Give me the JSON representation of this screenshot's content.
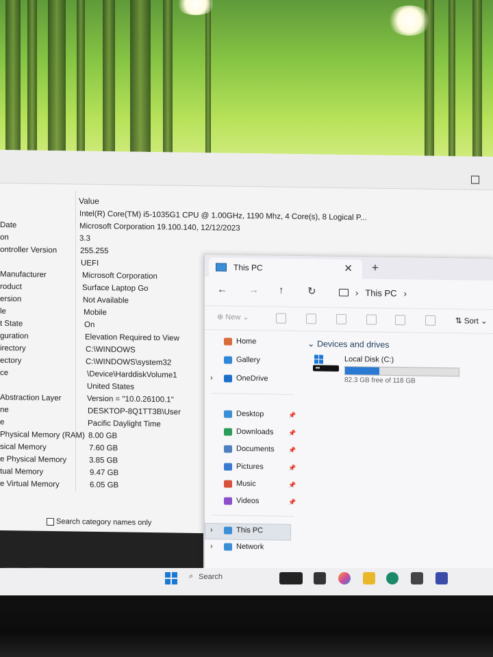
{
  "sysinfo": {
    "column_header": "Value",
    "rows": [
      {
        "item": "",
        "value": "Intel(R) Core(TM) i5-1035G1 CPU @ 1.00GHz, 1190 Mhz, 4 Core(s), 8 Logical P..."
      },
      {
        "item": "Date",
        "value": "Microsoft Corporation 19.100.140, 12/12/2023"
      },
      {
        "item": "on",
        "value": "3.3"
      },
      {
        "item": "ontroller Version",
        "value": "255.255"
      },
      {
        "item": "",
        "value": "UEFI"
      },
      {
        "item": "Manufacturer",
        "value": "Microsoft Corporation"
      },
      {
        "item": "roduct",
        "value": "Surface Laptop Go"
      },
      {
        "item": "ersion",
        "value": "Not Available"
      },
      {
        "item": "le",
        "value": "Mobile"
      },
      {
        "item": "t State",
        "value": "On"
      },
      {
        "item": "guration",
        "value": "Elevation Required to View"
      },
      {
        "item": "irectory",
        "value": "C:\\WINDOWS"
      },
      {
        "item": "ectory",
        "value": "C:\\WINDOWS\\system32"
      },
      {
        "item": "ce",
        "value": "\\Device\\HarddiskVolume1"
      },
      {
        "item": "",
        "value": "United States"
      },
      {
        "item": "Abstraction Layer",
        "value": "Version = \"10.0.26100.1\""
      },
      {
        "item": "ne",
        "value": "DESKTOP-8Q1TT3B\\User"
      },
      {
        "item": "e",
        "value": "Pacific Daylight Time"
      },
      {
        "item": "Physical Memory (RAM)",
        "value": "8.00 GB"
      },
      {
        "item": "sical Memory",
        "value": "7.60 GB"
      },
      {
        "item": "e Physical Memory",
        "value": "3.85 GB"
      },
      {
        "item": "tual Memory",
        "value": "9.47 GB"
      },
      {
        "item": "e Virtual Memory",
        "value": "6.05 GB"
      }
    ],
    "search_category_label": "Search category names only"
  },
  "explorer": {
    "tab_title": "This PC",
    "close_glyph": "✕",
    "new_tab_glyph": "+",
    "nav": {
      "back": "←",
      "forward": "→",
      "up": "↑",
      "refresh": "↻"
    },
    "address": {
      "location": "This PC",
      "chevron": "›"
    },
    "toolbar": {
      "new_label": "New",
      "sort_label": "Sort"
    },
    "nav_pane": {
      "top": [
        {
          "label": "Home",
          "color": "#d86b3a"
        },
        {
          "label": "Gallery",
          "color": "#2f87d8"
        },
        {
          "label": "OneDrive",
          "color": "#1a6fc9"
        }
      ],
      "quick": [
        {
          "label": "Desktop",
          "color": "#3a8fd6"
        },
        {
          "label": "Downloads",
          "color": "#2a9d5a"
        },
        {
          "label": "Documents",
          "color": "#4f7fbf"
        },
        {
          "label": "Pictures",
          "color": "#3b7ad1"
        },
        {
          "label": "Music",
          "color": "#d6503a"
        },
        {
          "label": "Videos",
          "color": "#8a4fc9"
        }
      ],
      "bottom": [
        {
          "label": "This PC",
          "color": "#3a8fd6"
        },
        {
          "label": "Network",
          "color": "#3a8fd6"
        }
      ]
    },
    "devices": {
      "group_title": "Devices and drives",
      "drive_name": "Local Disk (C:)",
      "free_text": "82.3 GB free of 118 GB",
      "used_fraction": 0.3
    }
  },
  "taskbar": {
    "search_label": "Search"
  }
}
